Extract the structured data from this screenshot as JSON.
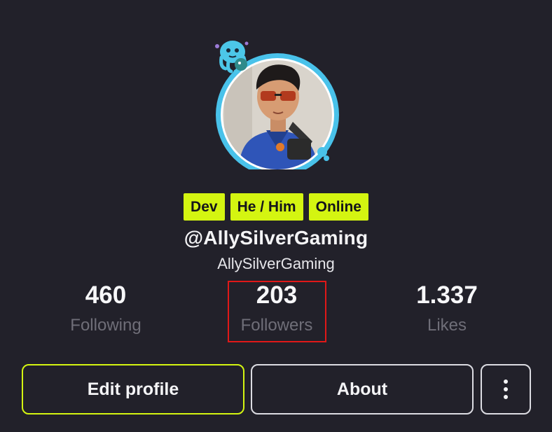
{
  "tags": [
    "Dev",
    "He / Him",
    "Online"
  ],
  "profile": {
    "handle": "@AllySilverGaming",
    "display_name": "AllySilverGaming"
  },
  "stats": {
    "following": {
      "value": "460",
      "label": "Following"
    },
    "followers": {
      "value": "203",
      "label": "Followers"
    },
    "likes": {
      "value": "1.337",
      "label": "Likes"
    }
  },
  "buttons": {
    "edit": "Edit profile",
    "about": "About",
    "more_icon": "more-vertical-icon"
  },
  "colors": {
    "background": "#22212a",
    "accent": "#d4f511",
    "ring": "#49c2ea",
    "highlight": "#e01818"
  }
}
